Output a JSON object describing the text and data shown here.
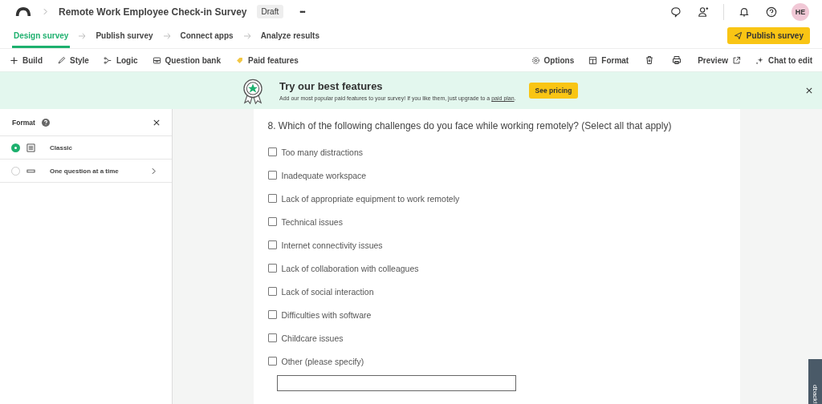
{
  "header": {
    "title": "Remote Work Employee Check-in Survey",
    "badge": "Draft",
    "more": "•••",
    "avatar": "HE"
  },
  "steps": [
    {
      "label": "Design survey",
      "selected": true
    },
    {
      "label": "Publish survey",
      "selected": false
    },
    {
      "label": "Connect apps",
      "selected": false
    },
    {
      "label": "Analyze results",
      "selected": false
    }
  ],
  "publish_button": "Publish survey",
  "toolbar_left": [
    "Build",
    "Style",
    "Logic",
    "Question bank",
    "Paid features"
  ],
  "toolbar_right": {
    "options": "Options",
    "format": "Format",
    "preview": "Preview",
    "chat": "Chat to edit"
  },
  "banner": {
    "title": "Try our best features",
    "text": "Add our most popular paid features to your survey! If you like them, just upgrade to a ",
    "link": "paid plan",
    "end": ".",
    "button": "See pricing"
  },
  "format_panel": {
    "title": "Format",
    "options": [
      {
        "label": "Classic",
        "selected": true
      },
      {
        "label": "One question at a time",
        "selected": false
      }
    ]
  },
  "question": {
    "title": "8. Which of the following challenges do you face while working remotely? (Select all that apply)",
    "choices": [
      {
        "label": "Too many distractions",
        "checked": false
      },
      {
        "label": "Inadequate workspace",
        "checked": false
      },
      {
        "label": "Lack of appropriate equipment to work remotely",
        "checked": false
      },
      {
        "label": "Technical issues",
        "checked": false
      },
      {
        "label": "Internet connectivity issues",
        "checked": false
      },
      {
        "label": "Lack of collaboration with colleagues",
        "checked": false
      },
      {
        "label": "Lack of social interaction",
        "checked": false
      },
      {
        "label": "Difficulties with software",
        "checked": false
      },
      {
        "label": "Childcare issues",
        "checked": false
      },
      {
        "label": "Other (please specify)",
        "checked": false
      }
    ]
  },
  "feedback_tab": "dback!"
}
